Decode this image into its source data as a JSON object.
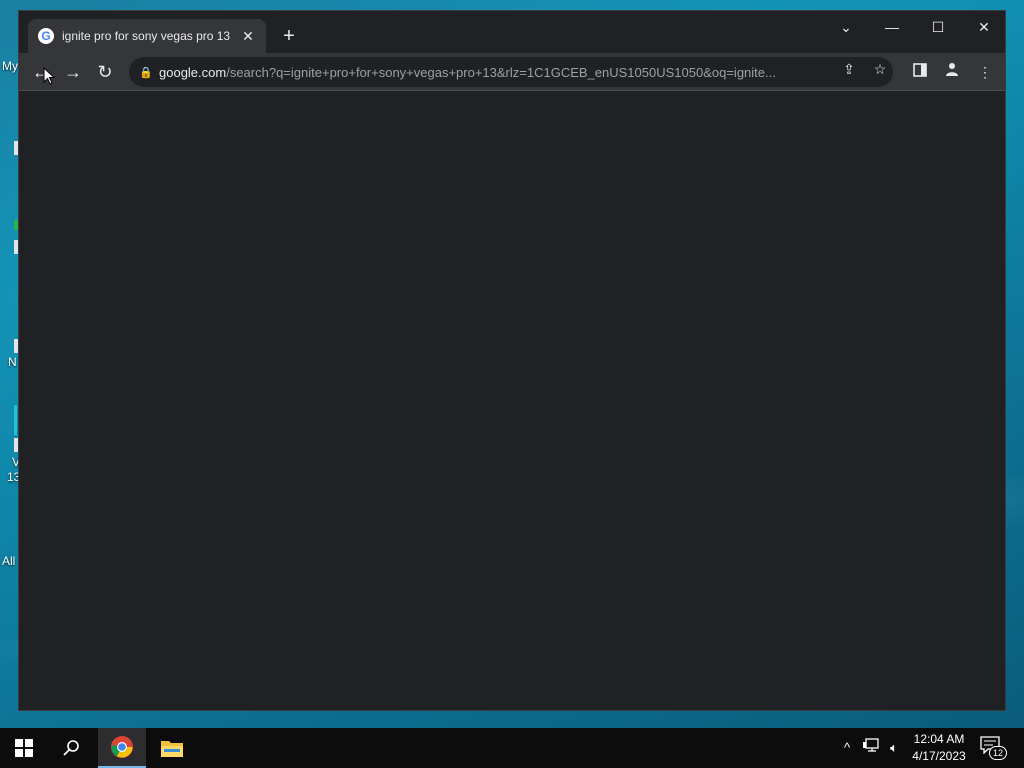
{
  "desktop": {
    "labels": [
      "My",
      "N",
      "V",
      "13",
      "All"
    ]
  },
  "browser": {
    "tab": {
      "title": "ignite pro for sony vegas pro 13",
      "favicon": "G"
    },
    "address": {
      "host": "google.com",
      "rest": "/search?q=ignite+pro+for+sony+vegas+pro+13&rlz=1C1GCEB_enUS1050US1050&oq=ignite..."
    },
    "icons": {
      "back": "back-arrow-icon",
      "forward": "forward-arrow-icon",
      "reload": "reload-icon",
      "share": "share-icon",
      "bookmark": "star-icon",
      "side_panel": "side-panel-icon",
      "profile": "profile-icon",
      "menu": "kebab-menu-icon"
    }
  },
  "taskbar": {
    "clock_time": "12:04 AM",
    "clock_date": "4/17/2023",
    "notification_count": "12"
  },
  "colors": {
    "browser_dark": "#202124",
    "toolbar": "#35363a",
    "taskbar": "#0c0c0d"
  }
}
